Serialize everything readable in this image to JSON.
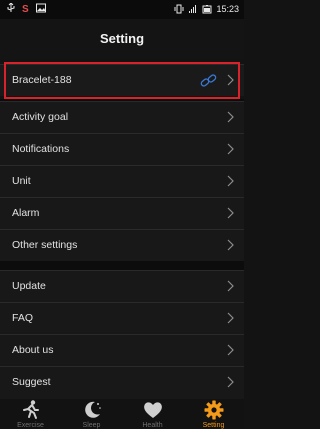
{
  "status": {
    "time": "15:23"
  },
  "header": {
    "title": "Setting"
  },
  "device": {
    "name": "Bracelet-188"
  },
  "groups": [
    {
      "items": [
        "Activity goal",
        "Notifications",
        "Unit",
        "Alarm",
        "Other settings"
      ]
    },
    {
      "items": [
        "Update",
        "FAQ",
        "About us",
        "Suggest"
      ]
    }
  ],
  "tabs": [
    {
      "label": "Exercise",
      "icon": "runner-icon",
      "active": false
    },
    {
      "label": "Sleep",
      "icon": "moon-icon",
      "active": false
    },
    {
      "label": "Health",
      "icon": "heart-icon",
      "active": false
    },
    {
      "label": "Setting",
      "icon": "gear-icon",
      "active": true
    }
  ],
  "colors": {
    "accent": "#f39a1b",
    "highlight_box": "#d9232a",
    "link": "#3a79d8"
  }
}
